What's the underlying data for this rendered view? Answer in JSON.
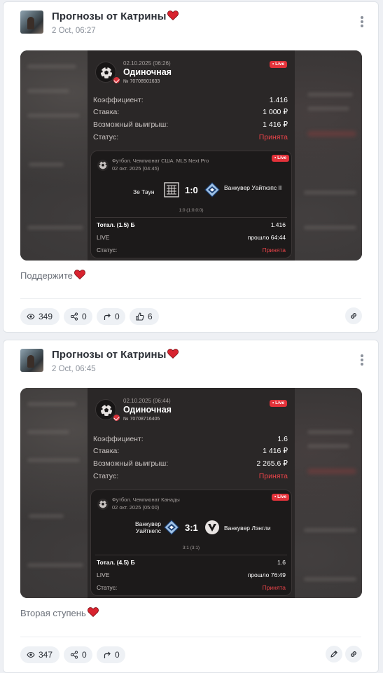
{
  "posts": [
    {
      "author": "Прогнозы от Катрины",
      "time": "2 Oct, 06:27",
      "ticket": {
        "date": "02.10.2025 (06:26)",
        "type": "Одиночная",
        "number": "№ 70708501633",
        "live": "Live",
        "rows": [
          {
            "label": "Коэффициент:",
            "value": "1.416"
          },
          {
            "label": "Ставка:",
            "value": "1 000 ₽"
          },
          {
            "label": "Возможный выигрыш:",
            "value": "1 416 ₽"
          },
          {
            "label": "Статус:",
            "value": "Принята"
          }
        ],
        "match": {
          "league": "Футбол. Чемпионат США. MLS Next Pro",
          "date": "02 окт. 2025 (04:45)",
          "live": "Live",
          "home": "Зе Таун",
          "away": "Ванкувер Уайткэпс II",
          "score": "1:0",
          "subscore": "1:0 (1:0;0:0)",
          "rows": [
            {
              "label": "Тотал. (1.5) Б",
              "value": "1.416"
            },
            {
              "label": "LIVE",
              "value": "прошло 64:44"
            },
            {
              "label": "Статус:",
              "value": "Принята"
            }
          ]
        }
      },
      "caption": "Поддержите",
      "stats": {
        "views": "349",
        "shares": "0",
        "reposts": "0",
        "likes": "6"
      }
    },
    {
      "author": "Прогнозы от Катрины",
      "time": "2 Oct, 06:45",
      "ticket": {
        "date": "02.10.2025 (06:44)",
        "type": "Одиночная",
        "number": "№ 70708716405",
        "live": "Live",
        "rows": [
          {
            "label": "Коэффициент:",
            "value": "1.6"
          },
          {
            "label": "Ставка:",
            "value": "1 416 ₽"
          },
          {
            "label": "Возможный выигрыш:",
            "value": "2 265.6 ₽"
          },
          {
            "label": "Статус:",
            "value": "Принята"
          }
        ],
        "match": {
          "league": "Футбол. Чемпионат Канады",
          "date": "02 окт. 2025 (05:00)",
          "live": "Live",
          "home": "Ванкувер Уайткепс",
          "away": "Ванкувер Лэнгли",
          "score": "3:1",
          "subscore": "3:1 (3:1)",
          "rows": [
            {
              "label": "Тотал. (4.5) Б",
              "value": "1.6"
            },
            {
              "label": "LIVE",
              "value": "прошло 76:49"
            },
            {
              "label": "Статус:",
              "value": "Принята"
            }
          ]
        }
      },
      "caption": "Вторая ступень",
      "stats": {
        "views": "347",
        "shares": "0",
        "reposts": "0"
      }
    }
  ],
  "colors": {
    "accent_red": "#e94349",
    "live_badge": "#e3323a",
    "heart": "#d8232f"
  },
  "icons": [
    "heart-icon",
    "more-vertical-icon",
    "eye-icon",
    "share-icon",
    "repost-arrow-icon",
    "thumbs-up-icon",
    "link-icon",
    "pencil-icon",
    "soccer-ball-icon",
    "check-badge-icon"
  ]
}
